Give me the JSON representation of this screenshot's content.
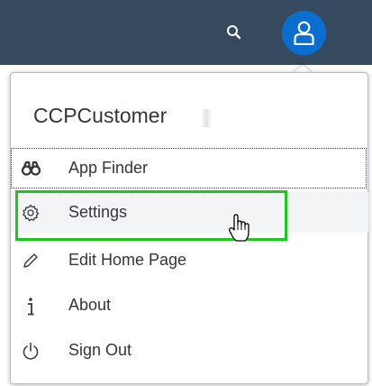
{
  "shell": {
    "bar_color": "#354a5f",
    "search_icon": "search-icon",
    "avatar_icon": "user-icon",
    "avatar_color": "#0a6ed1"
  },
  "user_menu": {
    "user_name": "CCPCustomer",
    "items": [
      {
        "label": "App Finder",
        "icon": "binoculars-icon"
      },
      {
        "label": "Settings",
        "icon": "gear-icon"
      },
      {
        "label": "Edit Home Page",
        "icon": "pencil-icon"
      },
      {
        "label": "About",
        "icon": "info-icon"
      },
      {
        "label": "Sign Out",
        "icon": "power-icon"
      }
    ]
  },
  "annotation": {
    "highlight_color": "#21c521",
    "highlighted_item": "Settings"
  }
}
